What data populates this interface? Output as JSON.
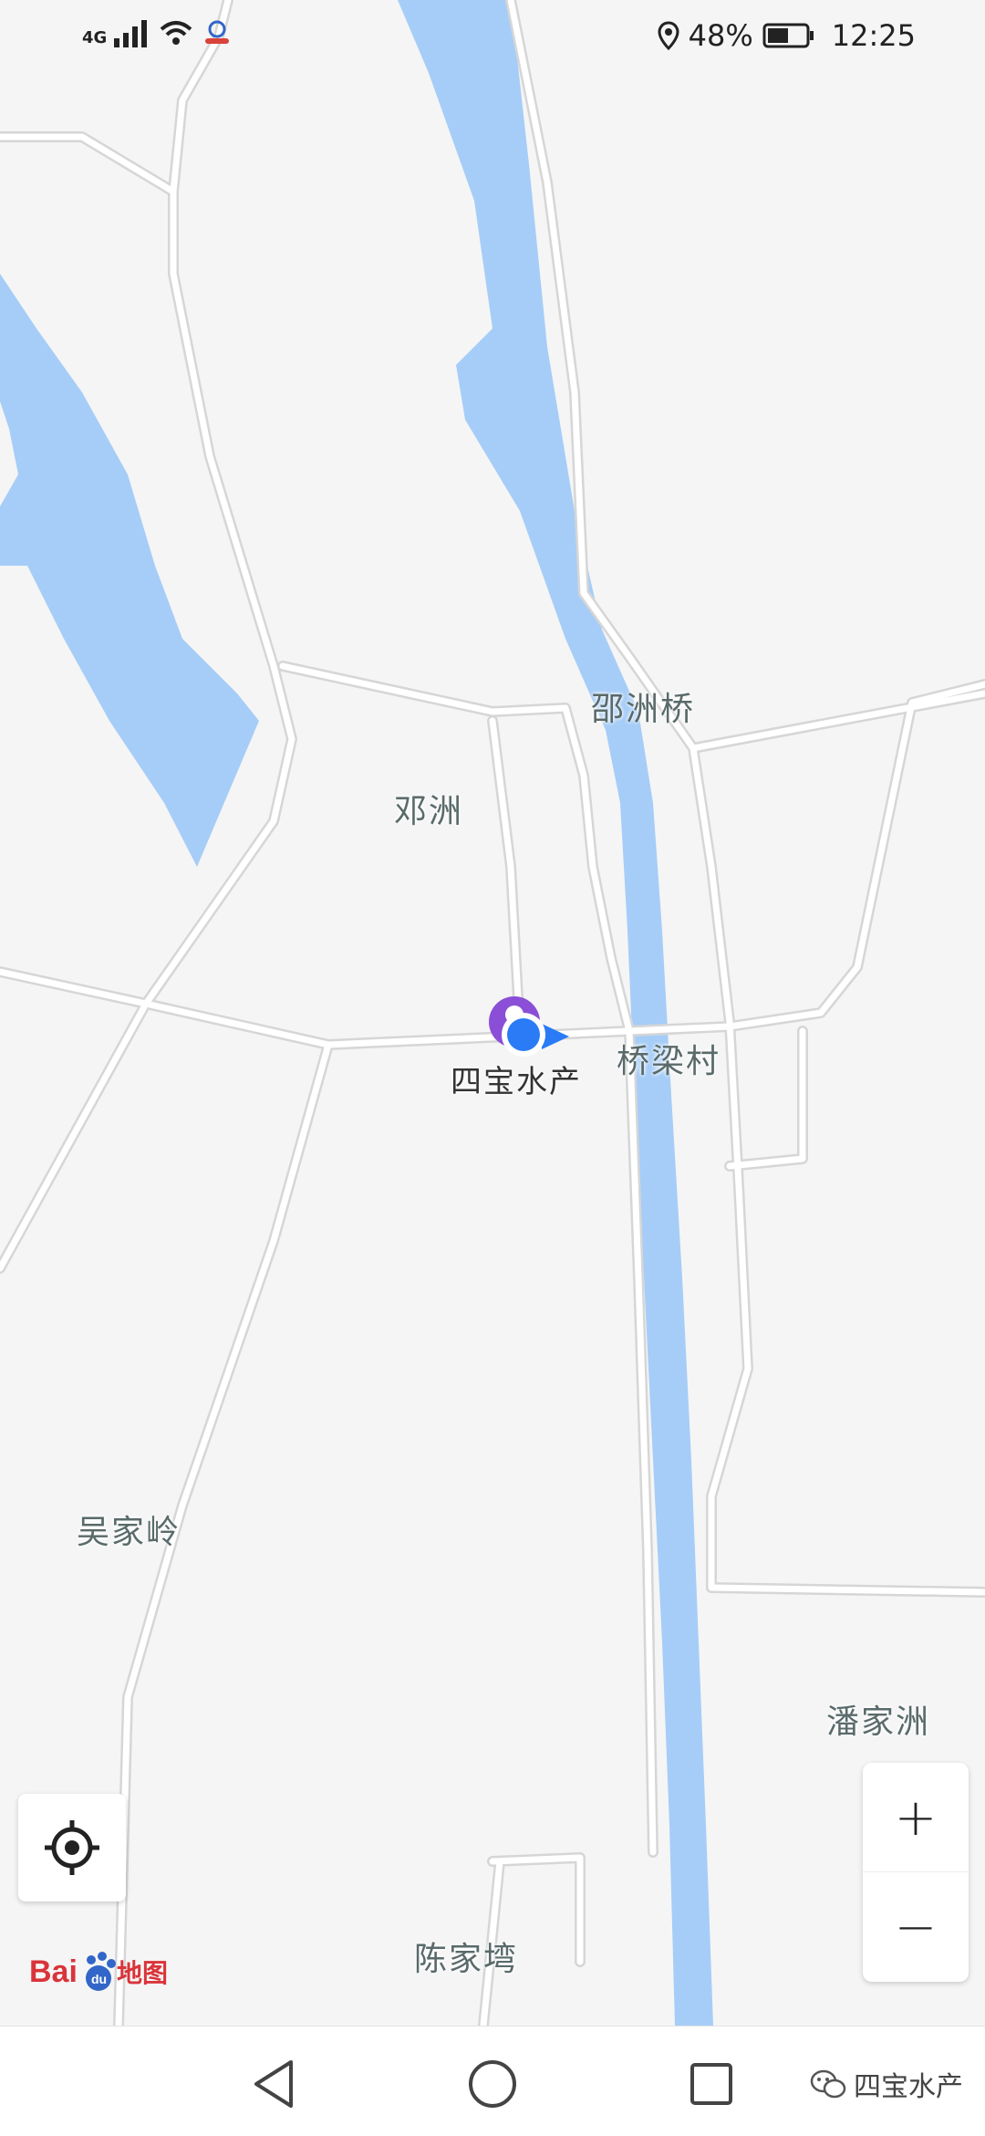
{
  "status_bar": {
    "network": "4G",
    "battery_percent": "48%",
    "time": "12:25"
  },
  "map": {
    "labels": {
      "shaozhou_bridge": "邵洲桥",
      "dengzhou": "邓洲",
      "qiaoliang_village": "桥梁村",
      "wujialing": "吴家岭",
      "panjiazhou": "潘家洲",
      "chenjiawan": "陈家塆"
    },
    "poi": {
      "name": "四宝水产"
    },
    "colors": {
      "water": "#a6cdf7",
      "road": "#ffffff",
      "road_edge": "#d6d6d6",
      "land": "#f5f5f5",
      "location_dot": "#2a7bf5",
      "poi_marker": "#8a4fd6"
    }
  },
  "controls": {
    "zoom_in": "+",
    "zoom_out": "−"
  },
  "branding": {
    "logo_text": "Bai du 地图"
  },
  "watermark": {
    "text": "四宝水产"
  },
  "navigation": {
    "back": "back-icon",
    "home": "home-icon",
    "recents": "recents-icon"
  }
}
